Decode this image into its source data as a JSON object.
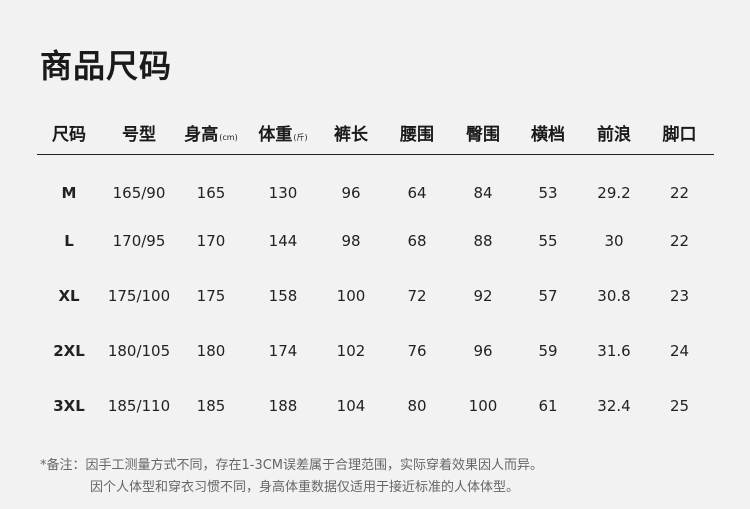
{
  "title": "商品尺码",
  "headers": [
    {
      "label": "尺码",
      "unit": ""
    },
    {
      "label": "号型",
      "unit": ""
    },
    {
      "label": "身高",
      "unit": "(cm)"
    },
    {
      "label": "体重",
      "unit": "(斤)"
    },
    {
      "label": "裤长",
      "unit": ""
    },
    {
      "label": "腰围",
      "unit": ""
    },
    {
      "label": "臀围",
      "unit": ""
    },
    {
      "label": "横档",
      "unit": ""
    },
    {
      "label": "前浪",
      "unit": ""
    },
    {
      "label": "脚口",
      "unit": ""
    }
  ],
  "rows": [
    [
      "M",
      "165/90",
      "165",
      "130",
      "96",
      "64",
      "84",
      "53",
      "29.2",
      "22"
    ],
    [
      "L",
      "170/95",
      "170",
      "144",
      "98",
      "68",
      "88",
      "55",
      "30",
      "22"
    ],
    [
      "XL",
      "175/100",
      "175",
      "158",
      "100",
      "72",
      "92",
      "57",
      "30.8",
      "23"
    ],
    [
      "2XL",
      "180/105",
      "180",
      "174",
      "102",
      "76",
      "96",
      "59",
      "31.6",
      "24"
    ],
    [
      "3XL",
      "185/110",
      "185",
      "188",
      "104",
      "80",
      "100",
      "61",
      "32.4",
      "25"
    ]
  ],
  "notes": {
    "line1": "*备注：因手工测量方式不同，存在1-3CM误差属于合理范围，实际穿着效果因人而异。",
    "line2": "因个人体型和穿衣习惯不同，身高体重数据仅适用于接近标准的人体体型。"
  }
}
